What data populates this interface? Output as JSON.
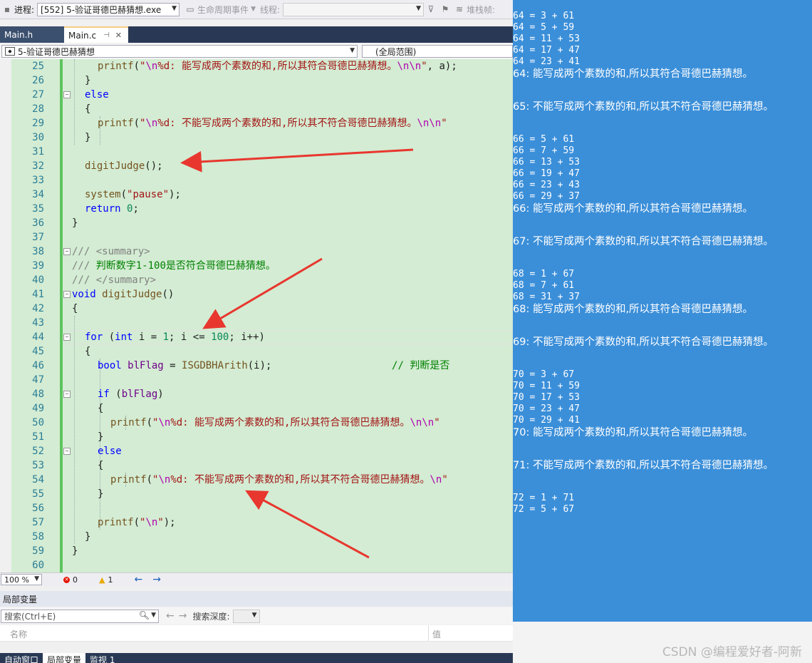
{
  "toolbar": {
    "process_label": "进程:",
    "process_value": "[552] 5-验证哥德巴赫猜想.exe",
    "lifecycle_label": "生命周期事件",
    "thread_label": "线程:",
    "stackframe_label": "堆栈帧:"
  },
  "tabs": [
    {
      "label": "Main.h"
    },
    {
      "label": "Main.c"
    }
  ],
  "navbar": {
    "scope": "5-验证哥德巴赫猜想",
    "global": "(全局范围)"
  },
  "code_lines": [
    {
      "n": "25",
      "html": "<span class=\"fn\">printf</span>(<span class=\"str\">\"<span class=\"esc\">\\n</span>%d: 能写成两个素数的和,所以其符合哥德巴赫猜想。<span class=\"esc\">\\n\\n</span>\"</span>, a);"
    },
    {
      "n": "26",
      "html": "}"
    },
    {
      "n": "27",
      "html": "<span class=\"kw\">else</span>"
    },
    {
      "n": "28",
      "html": "{"
    },
    {
      "n": "29",
      "html": "<span class=\"fn\">printf</span>(<span class=\"str\">\"<span class=\"esc\">\\n</span>%d: 不能写成两个素数的和,所以其不符合哥德巴赫猜想。<span class=\"esc\">\\n\\n</span>\"</span>"
    },
    {
      "n": "30",
      "html": "}"
    },
    {
      "n": "31",
      "html": ""
    },
    {
      "n": "32",
      "html": "<span class=\"fn\">digitJudge</span>();"
    },
    {
      "n": "33",
      "html": ""
    },
    {
      "n": "34",
      "html": "<span class=\"fn\">system</span>(<span class=\"str\">\"pause\"</span>);"
    },
    {
      "n": "35",
      "html": "<span class=\"kw\">return</span> <span class=\"num\">0</span>;"
    },
    {
      "n": "36",
      "html": "}"
    },
    {
      "n": "37",
      "html": ""
    },
    {
      "n": "38",
      "html": "<span class=\"cmg\">///</span> <span class=\"cmg\">&lt;summary&gt;</span>"
    },
    {
      "n": "39",
      "html": "<span class=\"cmg\">///</span> <span class=\"cm\">判断数字1-100是否符合哥德巴赫猜想。</span>"
    },
    {
      "n": "40",
      "html": "<span class=\"cmg\">///</span> <span class=\"cmg\">&lt;/summary&gt;</span>"
    },
    {
      "n": "41",
      "html": "<span class=\"kw\">void</span> <span class=\"fn\">digitJudge</span>()"
    },
    {
      "n": "42",
      "html": "{"
    },
    {
      "n": "43",
      "html": ""
    },
    {
      "n": "44",
      "html": "<span class=\"kw\">for</span> (<span class=\"kw\">int</span> i = <span class=\"num\">1</span>; i &lt;= <span class=\"num\">100</span>; i++)"
    },
    {
      "n": "45",
      "html": "{"
    },
    {
      "n": "46",
      "html": "<span class=\"kw\">bool</span> <span class=\"mac\">blFlag</span> = <span class=\"fn\">ISGDBHArith</span>(i);                    <span class=\"cm\">// 判断是否</span>"
    },
    {
      "n": "47",
      "html": ""
    },
    {
      "n": "48",
      "html": "<span class=\"kw\">if</span> (<span class=\"mac\">blFlag</span>)"
    },
    {
      "n": "49",
      "html": "{"
    },
    {
      "n": "50",
      "html": "<span class=\"fn\">printf</span>(<span class=\"str\">\"<span class=\"esc\">\\n</span>%d: 能写成两个素数的和,所以其符合哥德巴赫猜想。<span class=\"esc\">\\n\\n</span>\"</span>"
    },
    {
      "n": "51",
      "html": "}"
    },
    {
      "n": "52",
      "html": "<span class=\"kw\">else</span>"
    },
    {
      "n": "53",
      "html": "{"
    },
    {
      "n": "54",
      "html": "<span class=\"fn\">printf</span>(<span class=\"str\">\"<span class=\"esc\">\\n</span>%d: 不能写成两个素数的和,所以其不符合哥德巴赫猜想。<span class=\"esc\">\\n</span>\"</span>"
    },
    {
      "n": "55",
      "html": "}"
    },
    {
      "n": "56",
      "html": ""
    },
    {
      "n": "57",
      "html": "<span class=\"fn\">printf</span>(<span class=\"str\">\"<span class=\"esc\">\\n</span>\"</span>);"
    },
    {
      "n": "58",
      "html": "}"
    },
    {
      "n": "59",
      "html": "}"
    },
    {
      "n": "60",
      "html": ""
    }
  ],
  "status": {
    "zoom": "100 %",
    "errors": "0",
    "warnings": "1"
  },
  "locals": {
    "title": "局部变量",
    "search_placeholder": "搜索(Ctrl+E)",
    "search_depth_label": "搜索深度:",
    "col_name": "名称",
    "col_value": "值"
  },
  "bottom_tabs": [
    "自动窗口",
    "局部变量",
    "监视 1"
  ],
  "console_lines": [
    {
      "type": "eq",
      "text": "64 = 3 + 61"
    },
    {
      "type": "eq",
      "text": "64 = 5 + 59"
    },
    {
      "type": "eq",
      "text": "64 = 11 + 53"
    },
    {
      "type": "eq",
      "text": "64 = 17 + 47"
    },
    {
      "type": "eq",
      "text": "64 = 23 + 41"
    },
    {
      "type": "msg",
      "text": "64: 能写成两个素数的和,所以其符合哥德巴赫猜想。"
    },
    {
      "type": "msg",
      "text": "65: 不能写成两个素数的和,所以其不符合哥德巴赫猜想。"
    },
    {
      "type": "eq",
      "text": "66 = 5 + 61"
    },
    {
      "type": "eq",
      "text": "66 = 7 + 59"
    },
    {
      "type": "eq",
      "text": "66 = 13 + 53"
    },
    {
      "type": "eq",
      "text": "66 = 19 + 47"
    },
    {
      "type": "eq",
      "text": "66 = 23 + 43"
    },
    {
      "type": "eq",
      "text": "66 = 29 + 37"
    },
    {
      "type": "msg",
      "text": "66: 能写成两个素数的和,所以其符合哥德巴赫猜想。"
    },
    {
      "type": "msg",
      "text": "67: 不能写成两个素数的和,所以其不符合哥德巴赫猜想。"
    },
    {
      "type": "eq",
      "text": "68 = 1 + 67"
    },
    {
      "type": "eq",
      "text": "68 = 7 + 61"
    },
    {
      "type": "eq",
      "text": "68 = 31 + 37"
    },
    {
      "type": "msg",
      "text": "68: 能写成两个素数的和,所以其符合哥德巴赫猜想。"
    },
    {
      "type": "msg",
      "text": "69: 不能写成两个素数的和,所以其不符合哥德巴赫猜想。"
    },
    {
      "type": "eq",
      "text": "70 = 3 + 67"
    },
    {
      "type": "eq",
      "text": "70 = 11 + 59"
    },
    {
      "type": "eq",
      "text": "70 = 17 + 53"
    },
    {
      "type": "eq",
      "text": "70 = 23 + 47"
    },
    {
      "type": "eq",
      "text": "70 = 29 + 41"
    },
    {
      "type": "msg",
      "text": "70: 能写成两个素数的和,所以其符合哥德巴赫猜想。"
    },
    {
      "type": "msg",
      "text": "71: 不能写成两个素数的和,所以其不符合哥德巴赫猜想。"
    },
    {
      "type": "eq",
      "text": "72 = 1 + 71"
    },
    {
      "type": "eq",
      "text": "72 = 5 + 67"
    }
  ],
  "watermark": "CSDN @编程爱好者-阿新",
  "colors": {
    "editor_bg": "#d3ecd3",
    "console_bg": "#3b8fd9",
    "annotation_arrow": "#e8372f"
  }
}
